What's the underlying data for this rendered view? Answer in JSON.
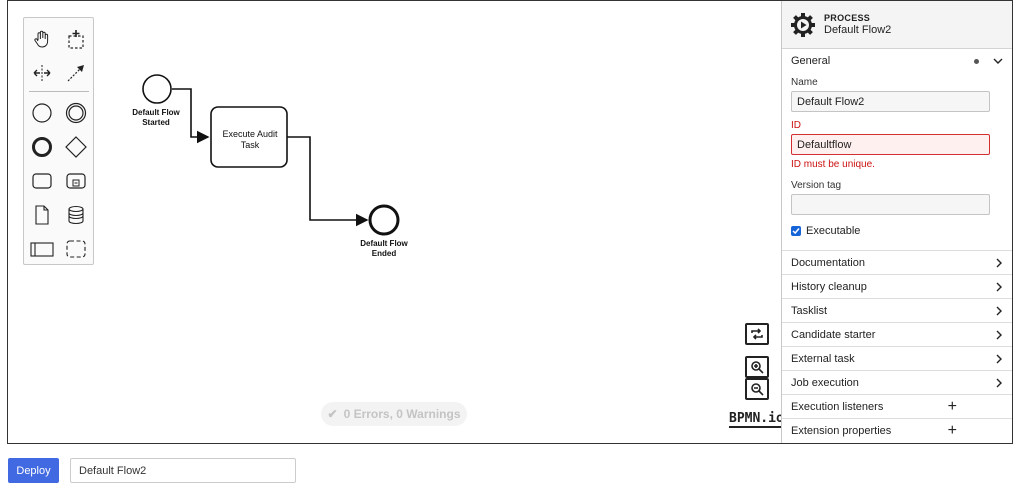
{
  "diagram": {
    "start_event_label": "Default Flow Started",
    "task_label": "Execute Audit Task",
    "end_event_label": "Default Flow Ended"
  },
  "palette": {
    "tools": [
      "hand-tool",
      "lasso-tool",
      "space-tool",
      "global-connect-tool",
      "start-event",
      "intermediate-event",
      "end-event",
      "gateway",
      "task",
      "subprocess",
      "data-object",
      "data-store",
      "pool",
      "group"
    ]
  },
  "status": {
    "text": "0 Errors, 0 Warnings"
  },
  "logo": {
    "text": "BPMN.io"
  },
  "properties": {
    "header_type": "PROCESS",
    "header_name": "Default Flow2",
    "general": {
      "title": "General",
      "name_label": "Name",
      "name_value": "Default Flow2",
      "id_label": "ID",
      "id_value": "Defaultflow",
      "id_error": "ID must be unique.",
      "version_tag_label": "Version tag",
      "version_tag_value": "",
      "executable_label": "Executable",
      "executable_checked": true
    },
    "groups": [
      {
        "label": "Documentation"
      },
      {
        "label": "History cleanup"
      },
      {
        "label": "Tasklist"
      },
      {
        "label": "Candidate starter"
      },
      {
        "label": "External task"
      },
      {
        "label": "Job execution"
      }
    ],
    "list_groups": [
      {
        "label": "Execution listeners"
      },
      {
        "label": "Extension properties"
      }
    ]
  },
  "bottom": {
    "deploy_label": "Deploy",
    "process_name_value": "Default Flow2"
  },
  "colors": {
    "deploy": "#4169e1",
    "error": "#cc1111",
    "checkbox": "#1565d8"
  }
}
